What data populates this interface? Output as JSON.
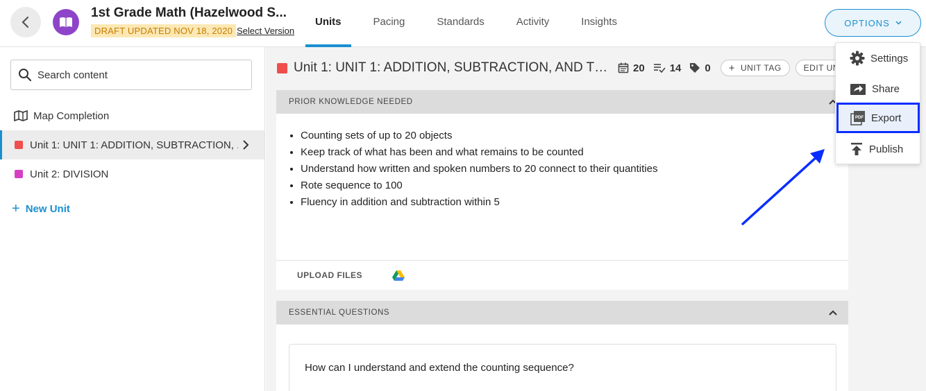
{
  "header": {
    "course_title": "1st Grade Math (Hazelwood S...",
    "draft_badge": "DRAFT UPDATED NOV 18, 2020",
    "select_version": "Select Version",
    "tabs": [
      {
        "label": "Units",
        "active": true
      },
      {
        "label": "Pacing",
        "active": false
      },
      {
        "label": "Standards",
        "active": false
      },
      {
        "label": "Activity",
        "active": false
      },
      {
        "label": "Insights",
        "active": false
      }
    ],
    "options_label": "OPTIONS"
  },
  "sidebar": {
    "search_placeholder": "Search content",
    "map_completion": "Map Completion",
    "units": [
      {
        "label": "Unit 1: UNIT 1: ADDITION, SUBTRACTION, ...",
        "color": "#f04d4d",
        "active": true
      },
      {
        "label": "Unit 2: DIVISION",
        "color": "#d63fc4",
        "active": false
      }
    ],
    "new_unit": "New Unit"
  },
  "unit": {
    "title": "Unit 1: UNIT 1: ADDITION, SUBTRACTION, AND TH...",
    "days": "20",
    "lessons": "14",
    "tags": "0",
    "unit_tag": "UNIT TAG",
    "edit_unit": "EDIT UNI"
  },
  "prior_knowledge": {
    "heading": "PRIOR KNOWLEDGE NEEDED",
    "items": [
      "Counting sets of up to 20 objects",
      "Keep track of what has been and what remains to be counted",
      "Understand how written and spoken numbers to 20 connect to their quantities",
      "Rote sequence to 100",
      "Fluency in addition and subtraction within 5"
    ],
    "upload_files": "UPLOAD FILES"
  },
  "essential_questions": {
    "heading": "ESSENTIAL QUESTIONS",
    "question": "How can I understand and extend the counting sequence?"
  },
  "options_menu": {
    "items": [
      {
        "label": "Settings",
        "icon": "gear-icon"
      },
      {
        "label": "Share",
        "icon": "share-icon"
      },
      {
        "label": "Export",
        "icon": "pdf-icon",
        "selected": true
      },
      {
        "label": "Publish",
        "icon": "upload-icon"
      }
    ]
  },
  "colors": {
    "accent": "#1a8fd0",
    "highlight_box": "#0a2dff",
    "course_badge": "#8e44c9"
  }
}
